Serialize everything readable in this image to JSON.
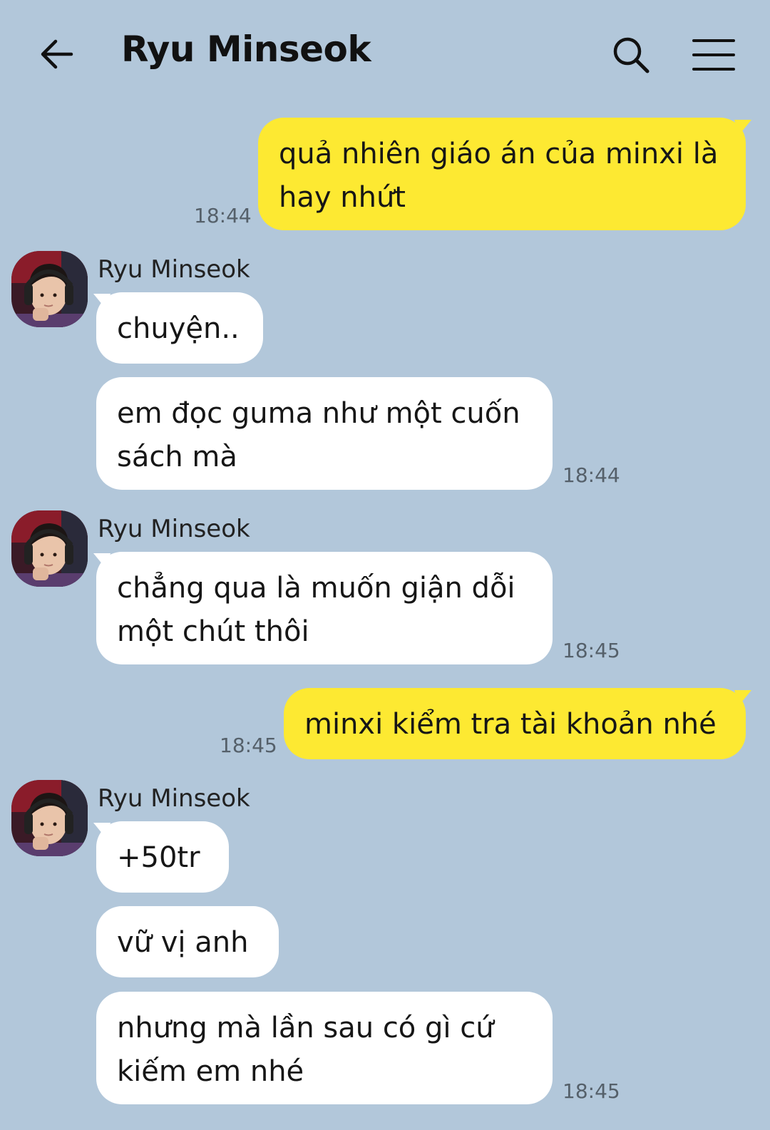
{
  "header": {
    "title": "Ryu Minseok",
    "back_icon": "arrow-left-icon",
    "search_icon": "search-icon",
    "menu_icon": "hamburger-menu-icon"
  },
  "colors": {
    "background": "#b2c7da",
    "my_bubble": "#fde932",
    "their_bubble": "#ffffff"
  },
  "messages": [
    {
      "from": "me",
      "lines": [
        "quả nhiên giáo án của minxi là",
        "hay nhứt"
      ],
      "time": "18:44"
    },
    {
      "from": "them",
      "sender": "Ryu Minseok",
      "lines": [
        "chuyện.."
      ]
    },
    {
      "from": "them",
      "lines": [
        "em đọc guma như một cuốn",
        "sách mà"
      ],
      "time": "18:44"
    },
    {
      "from": "them",
      "sender": "Ryu Minseok",
      "lines": [
        "chẳng qua là muốn giận dỗi",
        "một chút thôi"
      ],
      "time": "18:45"
    },
    {
      "from": "me",
      "lines": [
        "minxi kiểm tra tài khoản nhé"
      ],
      "time": "18:45"
    },
    {
      "from": "them",
      "sender": "Ryu Minseok",
      "lines": [
        "+50tr"
      ]
    },
    {
      "from": "them",
      "lines": [
        "vữ vị anh"
      ]
    },
    {
      "from": "them",
      "lines": [
        "nhưng mà lần sau có gì cứ",
        "kiếm em nhé"
      ],
      "time": "18:45"
    }
  ]
}
